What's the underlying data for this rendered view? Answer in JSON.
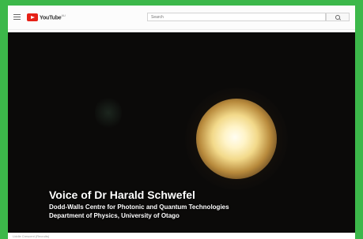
{
  "header": {
    "logo_text": "YouTube",
    "logo_suffix": "AU",
    "search_placeholder": "Search"
  },
  "video": {
    "caption_name": "Voice of Dr Harald Schwefel",
    "caption_affiliation": "Dodd-Walls Centre for Photonic and Quantum Technologies",
    "caption_department": "Department of Physics, University of Otago"
  },
  "below_video": {
    "text": "Liddle Crescent (Recruits)"
  },
  "colors": {
    "border_background": "#3cb84a",
    "logo_red": "#e62117",
    "player_background": "#0b0a09"
  }
}
